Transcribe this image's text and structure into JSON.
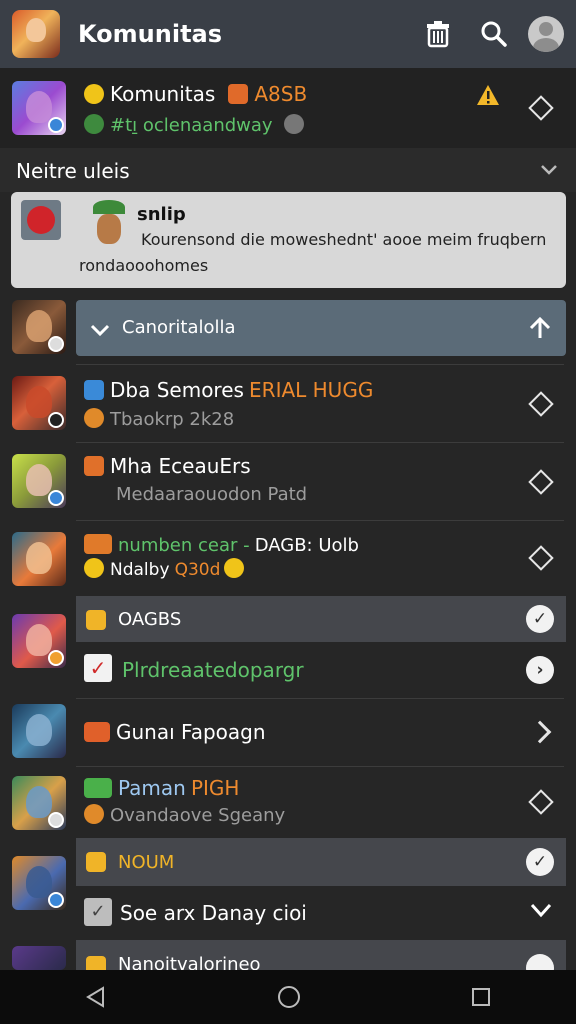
{
  "header": {
    "title": "Komunitas",
    "icons": [
      "trash-icon",
      "search-icon",
      "avatar"
    ]
  },
  "featured": {
    "title": "Komunitas",
    "tag": "A8SB",
    "subtitle": "#tı̱  oclenaandway",
    "icons": [
      "check-badge-icon",
      "warning-icon",
      "diamond-icon"
    ]
  },
  "section": {
    "title": "Neitre uleis"
  },
  "notice": {
    "title": "snlip",
    "body_line1": "Kourensond die moweshednt' aooe meim fruqbern",
    "body_line2": "rondaooohomes"
  },
  "rows": [
    {
      "title": "Canoritalolla",
      "expanded": true
    },
    {
      "title": "Dba Semores",
      "tag": "ERIAL HUGG",
      "subtitle": "Tbaokrp 2k28"
    },
    {
      "title": "Mha EceauErs",
      "subtitle": "Medaaraouodon Patd"
    },
    {
      "title_part1": "numben cear -",
      "title_part2": "DAGB: Uolb",
      "subtitle_part1": "Ndalby",
      "subtitle_part2": "Q30d"
    },
    {
      "group_label": "OAGBS",
      "item": "Plrdreaatedopargr"
    },
    {
      "title": "Gunaı Fapoagn"
    },
    {
      "title": "Paman",
      "tag": "PIGH",
      "subtitle": "Ovandaove Sgeany"
    },
    {
      "group_label": "NOUM",
      "item": "Soe arx Danay cioi"
    },
    {
      "title": "Nanoitvalorineo"
    }
  ],
  "colors": {
    "topbar": "#3a3f47",
    "accent_orange": "#ee8a2e",
    "accent_green": "#5fc36b",
    "expanded_bg": "#5b6b78"
  }
}
